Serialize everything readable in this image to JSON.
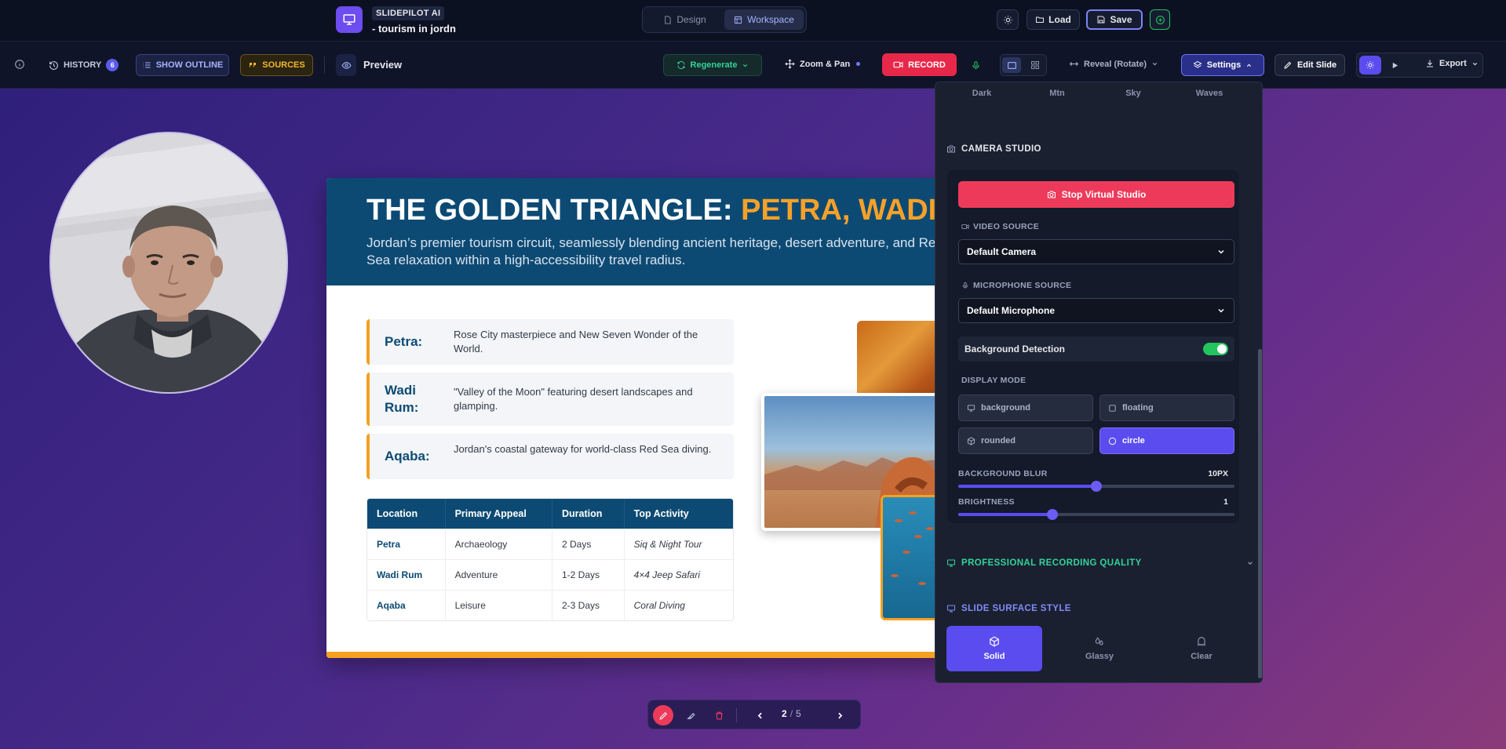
{
  "app": {
    "brand_tag": "SLIDEPILOT AI",
    "project_title": "- tourism in jordn"
  },
  "topbar": {
    "tabs": [
      {
        "label": "Design",
        "active": false
      },
      {
        "label": "Workspace",
        "active": true
      }
    ],
    "load_label": "Load",
    "save_label": "Save"
  },
  "toolbar": {
    "history_label": "HISTORY",
    "history_count": "6",
    "outline_label": "SHOW OUTLINE",
    "sources_label": "SOURCES",
    "preview_label": "Preview",
    "regenerate_label": "Regenerate",
    "zoom_label": "Zoom & Pan",
    "record_label": "RECORD",
    "transition_label": "Reveal (Rotate)",
    "settings_label": "Settings",
    "edit_label": "Edit Slide",
    "export_label": "Export"
  },
  "slide": {
    "title_part1": "THE GOLDEN TRIANGLE: ",
    "title_part2": "PETRA, WADI RUM, AQABA",
    "subtitle": "Jordan’s premier tourism circuit, seamlessly blending ancient heritage, desert adventure, and Red Sea relaxation within a high-accessibility travel radius.",
    "cards": [
      {
        "label": "Petra:",
        "text": "Rose City masterpiece and New Seven Wonder of the World."
      },
      {
        "label": "Wadi Rum:",
        "text": "\"Valley of the Moon\" featuring desert landscapes and glamping."
      },
      {
        "label": "Aqaba:",
        "text": "Jordan's coastal gateway for world-class Red Sea diving."
      }
    ],
    "table": {
      "headers": [
        "Location",
        "Primary Appeal",
        "Duration",
        "Top Activity"
      ],
      "rows": [
        [
          "Petra",
          "Archaeology",
          "2 Days",
          "Siq & Night Tour"
        ],
        [
          "Wadi Rum",
          "Adventure",
          "1-2 Days",
          "4×4 Jeep Safari"
        ],
        [
          "Aqaba",
          "Leisure",
          "2-3 Days",
          "Coral Diving"
        ]
      ]
    }
  },
  "panel": {
    "swatches": [
      "Dark",
      "Mtn",
      "Sky",
      "Waves"
    ],
    "camera_studio_title": "CAMERA STUDIO",
    "stop_label": "Stop Virtual Studio",
    "video_source_label": "VIDEO SOURCE",
    "video_source_value": "Default Camera",
    "mic_source_label": "MICROPHONE SOURCE",
    "mic_source_value": "Default Microphone",
    "bg_detection_label": "Background Detection",
    "bg_detection_on": true,
    "display_mode_label": "DISPLAY MODE",
    "modes": [
      {
        "label": "background",
        "active": false
      },
      {
        "label": "floating",
        "active": false
      },
      {
        "label": "rounded",
        "active": false
      },
      {
        "label": "circle",
        "active": true
      }
    ],
    "blur_label": "BACKGROUND BLUR",
    "blur_value": "10PX",
    "blur_fraction": 0.5,
    "brightness_label": "BRIGHTNESS",
    "brightness_value": "1",
    "brightness_fraction": 0.34,
    "pro_quality_label": "PROFESSIONAL RECORDING QUALITY",
    "surface_title": "SLIDE SURFACE STYLE",
    "surfaces": [
      {
        "label": "Solid",
        "active": true
      },
      {
        "label": "Glassy",
        "active": false
      },
      {
        "label": "Clear",
        "active": false
      }
    ]
  },
  "pager": {
    "current": "2",
    "total": "5"
  },
  "colors": {
    "accent": "#5b4cf0",
    "record": "#ee3a5a",
    "slide_header": "#0d4a73",
    "slide_highlight": "#f6a12a",
    "success": "#22c55e"
  }
}
